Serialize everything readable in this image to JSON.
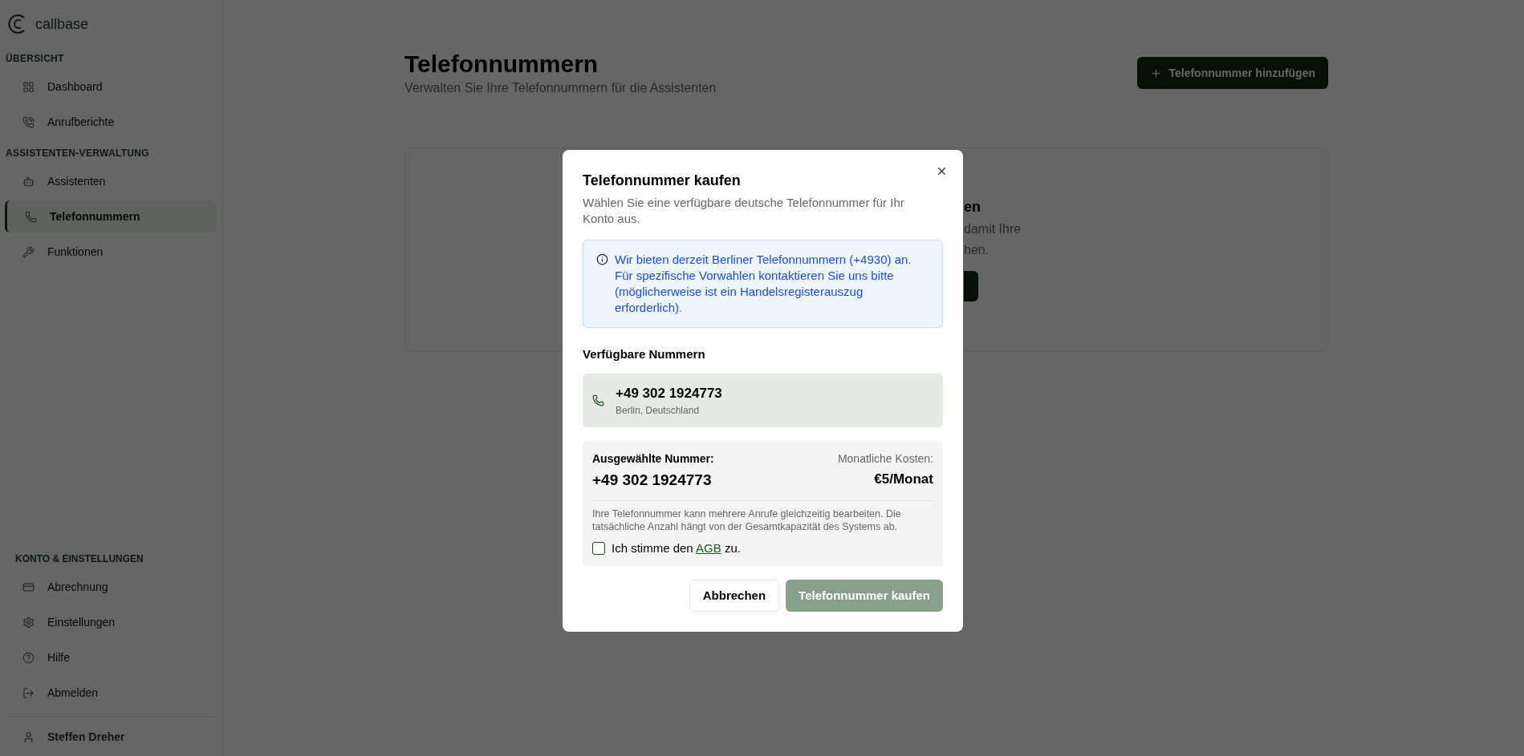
{
  "sidebar": {
    "logo": "callbase",
    "sections": [
      {
        "title": "ÜBERSICHT",
        "items": [
          {
            "label": "Dashboard",
            "selected": false
          },
          {
            "label": "Anrufberichte",
            "selected": false
          }
        ]
      },
      {
        "title": "ASSISTENTEN-VERWALTUNG",
        "items": [
          {
            "label": "Assistenten",
            "selected": false
          },
          {
            "label": "Telefonnummern",
            "selected": true
          },
          {
            "label": "Funktionen",
            "selected": false
          }
        ]
      }
    ],
    "account": {
      "title": "KONTO & EINSTELLUNGEN",
      "items": [
        {
          "label": "Abrechnung",
          "selected": false
        },
        {
          "label": "Einstellungen",
          "selected": false
        },
        {
          "label": "Hilfe",
          "selected": false
        },
        {
          "label": "Abmelden",
          "selected": false
        }
      ]
    },
    "user": "Steffen Dreher"
  },
  "header": {
    "title": "Telefonnummern",
    "subtitle": "Verwalten Sie Ihre Telefonnummern für die Assistenten",
    "add_button": "Telefonnummer hinzufügen"
  },
  "empty_card": {
    "title_fragment": "en",
    "text_fragments": [
      "damit Ihre",
      "hen."
    ]
  },
  "dialog": {
    "title": "Telefonnummer kaufen",
    "description": "Wählen Sie eine verfügbare deutsche Telefonnummer für Ihr Konto aus.",
    "notice": "Wir bieten derzeit Berliner Telefonnummern (+4930) an. Für spezifische Vorwahlen kontaktieren Sie uns bitte (möglicherweise ist ein Handelsregisterauszug erforderlich).",
    "numbers_label": "Verfügbare Nummern",
    "numbers": [
      {
        "number": "+49 302 1924773",
        "location": "Berlin, Deutschland",
        "selected": true
      }
    ],
    "summary": {
      "selected_label": "Ausgewählte Nummer:",
      "selected_number": "+49 302 1924773",
      "cost_label": "Monatliche Kosten:",
      "cost": "€5/Monat",
      "note": "Ihre Telefonnummer kann mehrere Anrufe gleichzeitig bearbeiten. Die tatsächliche Anzahl hängt von der Gesamtkapazität des Systems ab."
    },
    "terms": {
      "before": "Ich stimme den",
      "link": "AGB",
      "after": "zu.",
      "checked": false
    },
    "cancel": "Abbrechen",
    "buy": {
      "label": "Telefonnummer kaufen",
      "disabled": true
    }
  }
}
